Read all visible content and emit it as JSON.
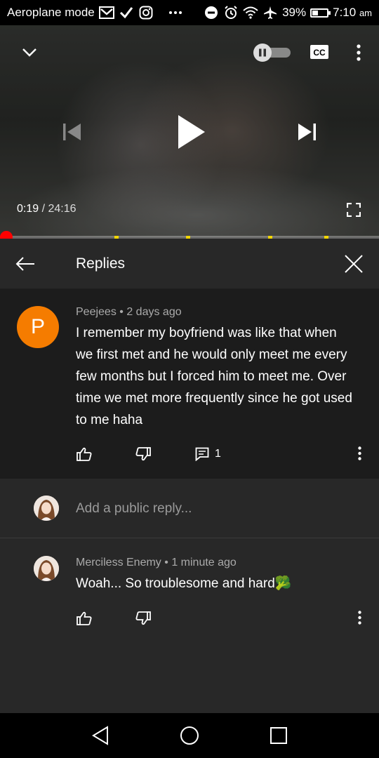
{
  "status_bar": {
    "mode_label": "Aeroplane mode",
    "battery_percent": "39%",
    "battery_level": 0.39,
    "time": "7:10",
    "time_suffix": "am"
  },
  "player": {
    "current_time": "0:19",
    "separator": " / ",
    "duration": "24:16",
    "progress": 0.013,
    "autoplay_on": false
  },
  "replies_header": {
    "title": "Replies"
  },
  "top_comment": {
    "avatar_letter": "P",
    "avatar_color": "#f57c00",
    "author": "Peejees",
    "age": "2 days ago",
    "meta_sep": " • ",
    "text": "I remember my boyfriend was like that when we first met and he would only meet me every few months but I forced him to meet me. Over time we met more frequently since he got used to me haha",
    "reply_count": "1"
  },
  "add_reply": {
    "placeholder": "Add a public reply..."
  },
  "reply": {
    "author": "Merciless Enemy",
    "age": "1 minute ago",
    "meta_sep": " • ",
    "text": "Woah... So troublesome and hard🥦"
  },
  "icons": {
    "status": [
      "gmail-icon",
      "check-icon",
      "instagram-icon",
      "more-dots-icon",
      "do-not-disturb-icon",
      "alarm-icon",
      "wifi-icon",
      "airplane-icon",
      "battery-icon"
    ],
    "player": [
      "collapse-chevron-icon",
      "autoplay-toggle",
      "cc-icon",
      "more-vert-icon",
      "previous-icon",
      "play-icon",
      "next-icon",
      "fullscreen-icon"
    ],
    "nav": [
      "back-triangle-icon",
      "home-circle-icon",
      "recents-square-icon"
    ]
  },
  "colors": {
    "accent_red": "#ff0000",
    "chapter_marker": "#f2d600",
    "background": "#282828",
    "comment_background": "#1c1c1c"
  }
}
